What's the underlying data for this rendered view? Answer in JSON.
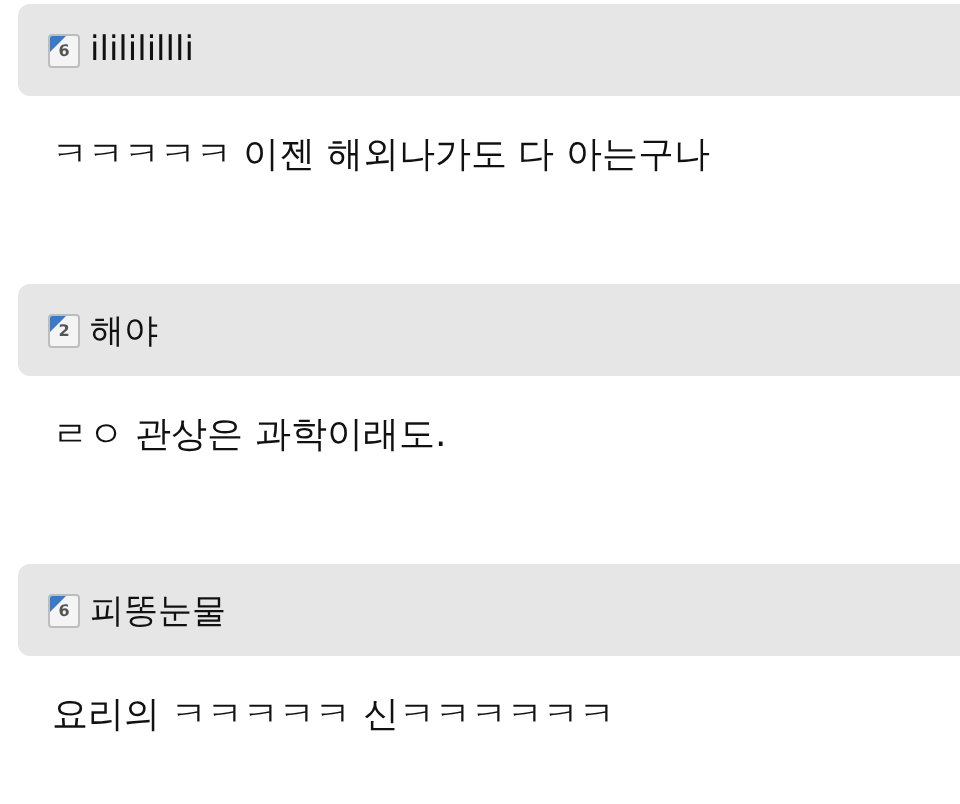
{
  "comments": [
    {
      "rank": "6",
      "author": "ilililillli",
      "text": "ㅋㅋㅋㅋㅋ 이젠 해외나가도 다 아는구나"
    },
    {
      "rank": "2",
      "author": "해야",
      "text": "ㄹㅇ 관상은 과학이래도."
    },
    {
      "rank": "6",
      "author": "피똥눈물",
      "text": "요리의 ㅋㅋㅋㅋㅋ 신ㅋㅋㅋㅋㅋㅋ"
    }
  ]
}
